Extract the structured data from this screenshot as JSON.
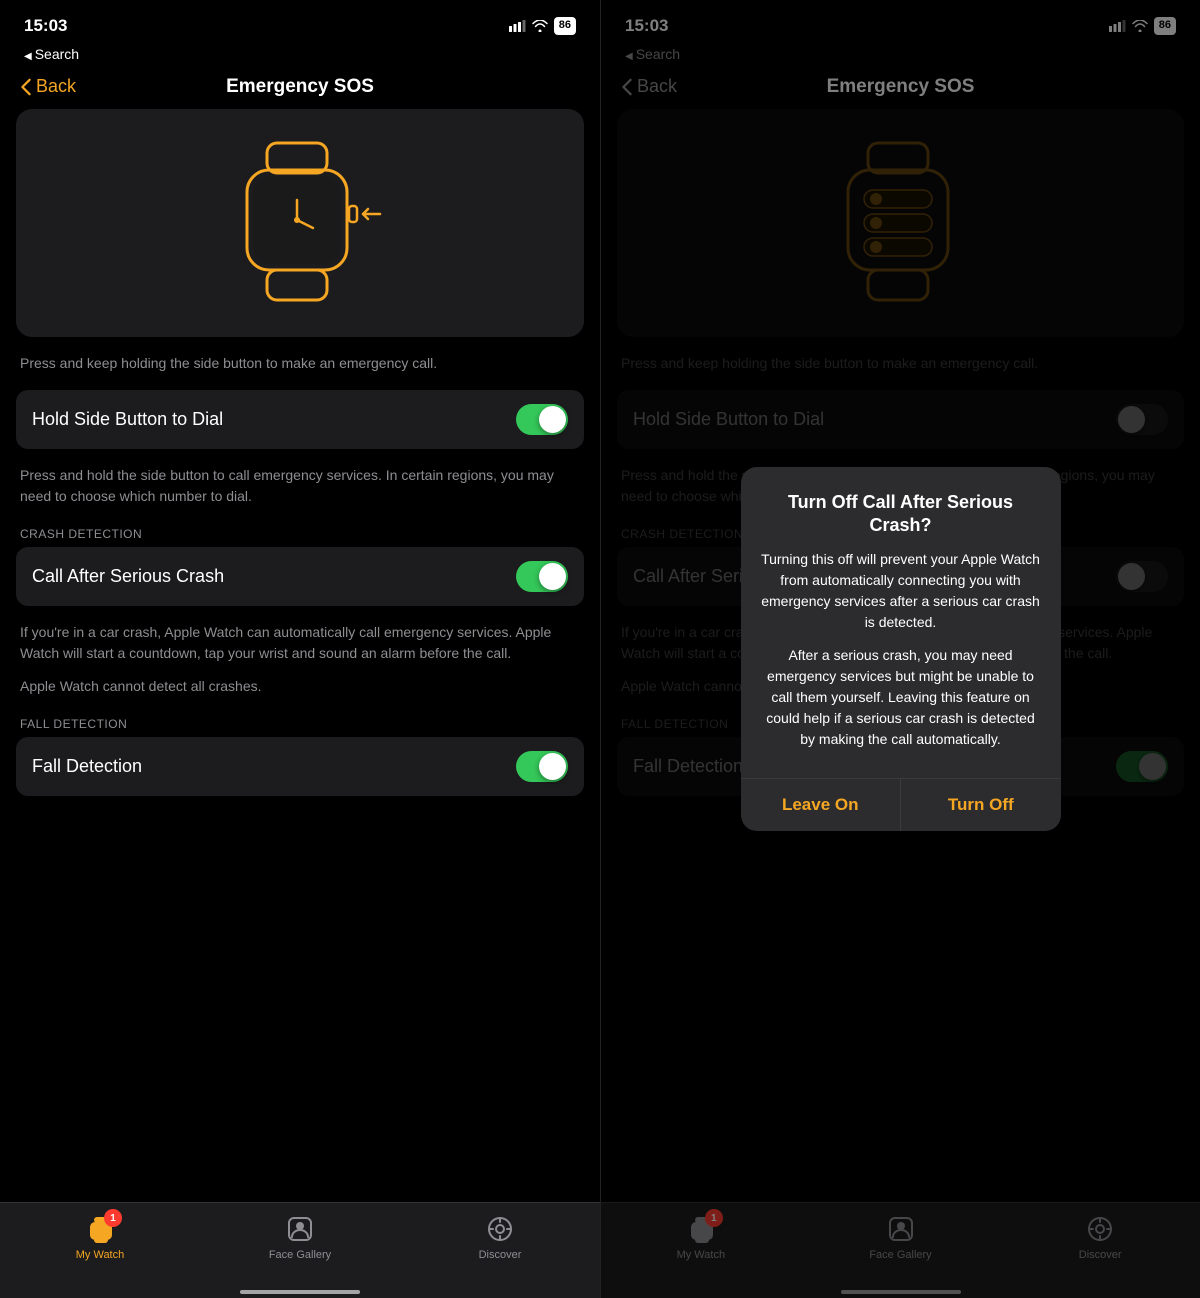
{
  "left_screen": {
    "status_time": "15:03",
    "search_back_label": "Search",
    "nav_back_label": "Back",
    "nav_title": "Emergency SOS",
    "watch_description": "Press and keep holding the side button to make an emergency call.",
    "hold_side_button": {
      "label": "Hold Side Button to Dial",
      "toggle_on": true,
      "description": "Press and hold the side button to call emergency services. In certain regions, you may need to choose which number to dial."
    },
    "crash_detection_section": "CRASH DETECTION",
    "call_after_crash": {
      "label": "Call After Serious Crash",
      "toggle_on": true,
      "description": "If you're in a car crash, Apple Watch can automatically call emergency services. Apple Watch will start a countdown, tap your wrist and sound an alarm before the call.",
      "note": "Apple Watch cannot detect all crashes."
    },
    "fall_detection_section": "FALL DETECTION",
    "fall_detection": {
      "label": "Fall Detection",
      "toggle_on": true
    },
    "battery": "86",
    "tabs": [
      {
        "id": "my-watch",
        "label": "My Watch",
        "active": true,
        "badge": 1
      },
      {
        "id": "face-gallery",
        "label": "Face Gallery",
        "active": false
      },
      {
        "id": "discover",
        "label": "Discover",
        "active": false
      }
    ]
  },
  "right_screen": {
    "status_time": "15:03",
    "search_back_label": "Search",
    "nav_back_label": "Back",
    "nav_title": "Emergency SOS",
    "watch_description": "Press and keep holding the side button to make an emergency call.",
    "hold_side_button": {
      "label": "Hold Side Button to Dial",
      "toggle_on": false,
      "description": "Press and hold the side button to call emergency services. In certain regions, you may need to choose which number to dial."
    },
    "crash_detection_section": "CRASH DETECTION",
    "call_after_crash": {
      "label": "Call After Serious Crash",
      "toggle_on": false,
      "description": "If you're in a car crash, Apple Watch can automatically call emergency services. Apple Watch will start a countdown, tap your wrist and sound an alarm before the call.",
      "note": "Apple Watch cannot detect all crashes."
    },
    "fall_detection_section": "FALL DETECTION",
    "fall_detection": {
      "label": "Fall Detection",
      "toggle_on": true
    },
    "battery": "86",
    "tabs": [
      {
        "id": "my-watch",
        "label": "My Watch",
        "active": false,
        "badge": 1
      },
      {
        "id": "face-gallery",
        "label": "Face Gallery",
        "active": false
      },
      {
        "id": "discover",
        "label": "Discover",
        "active": false
      }
    ],
    "modal": {
      "title": "Turn Off Call After Serious Crash?",
      "paragraph1": "Turning this off will prevent your Apple Watch from automatically connecting you with emergency services after a serious car crash is detected.",
      "paragraph2": "After a serious crash, you may need emergency services but might be unable to call them yourself. Leaving this feature on could help if a serious car crash is detected by making the call automatically.",
      "btn_leave_on": "Leave On",
      "btn_turn_off": "Turn Off"
    }
  }
}
